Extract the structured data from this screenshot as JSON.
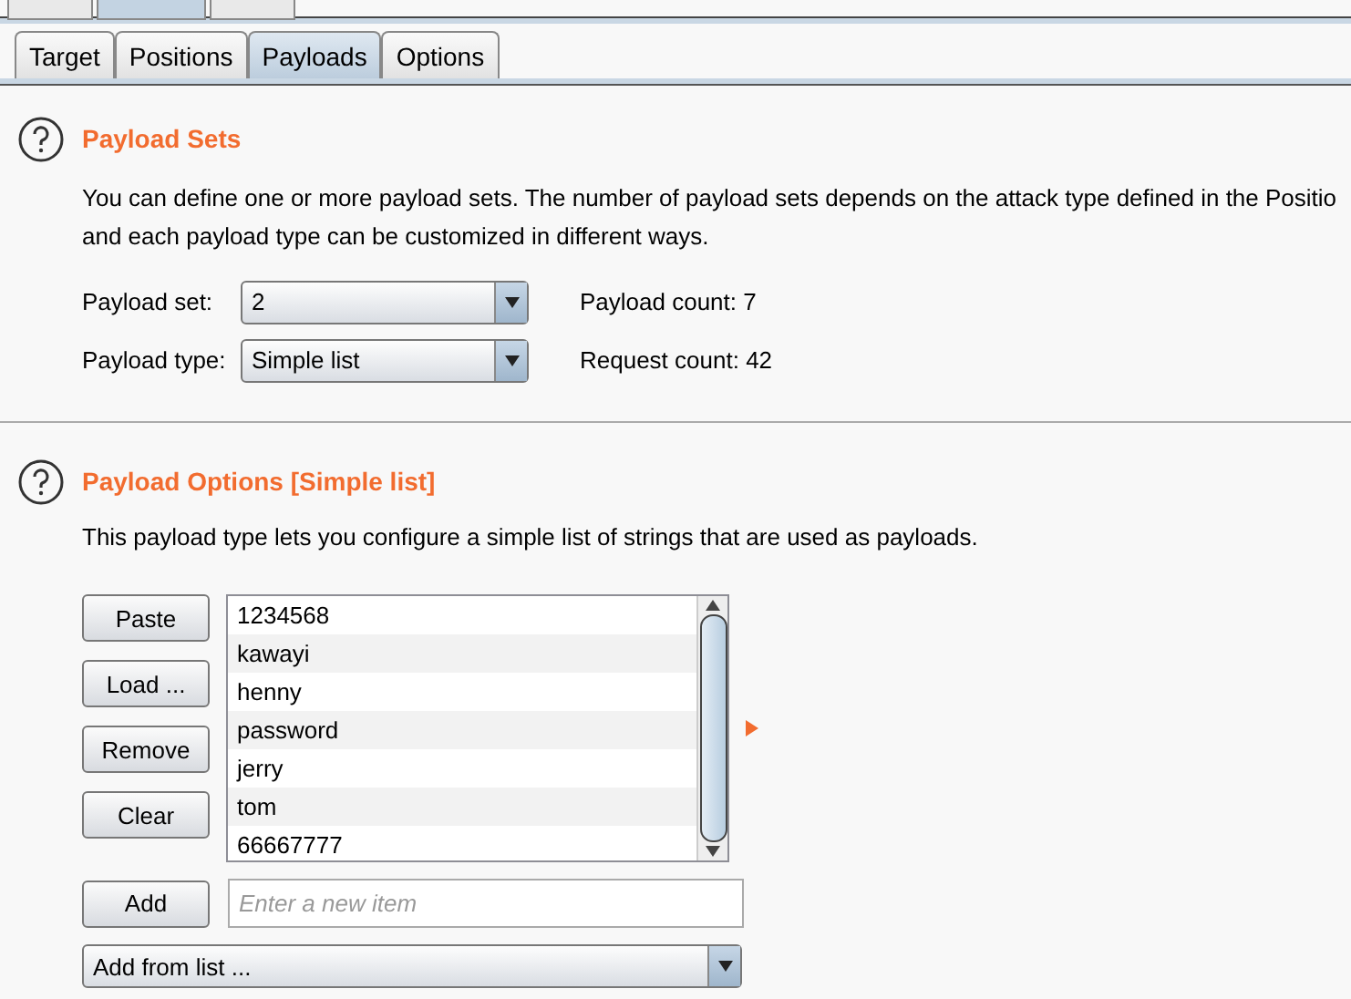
{
  "outer_tabs": [
    {
      "selected": false
    },
    {
      "selected": true
    },
    {
      "selected": false
    }
  ],
  "tabs": [
    {
      "label": "Target",
      "selected": false
    },
    {
      "label": "Positions",
      "selected": false
    },
    {
      "label": "Payloads",
      "selected": true
    },
    {
      "label": "Options",
      "selected": false
    }
  ],
  "payload_sets": {
    "title": "Payload Sets",
    "description": "You can define one or more payload sets. The number of payload sets depends on the attack type defined in the Positio",
    "description_2": "and each payload type can be customized in different ways.",
    "fields": [
      {
        "label": "Payload set:",
        "value": "2",
        "info_label": "Payload count:",
        "info_value": "7"
      },
      {
        "label": "Payload type:",
        "value": "Simple list",
        "info_label": "Request count:",
        "info_value": "42"
      }
    ]
  },
  "payload_options": {
    "title": "Payload Options [Simple list]",
    "description": "This payload type lets you configure a simple list of strings that are used as payloads.",
    "buttons": [
      "Paste",
      "Load ...",
      "Remove",
      "Clear"
    ],
    "items": [
      "1234568",
      "kawayi",
      "henny",
      "password",
      "jerry",
      "tom",
      "66667777"
    ],
    "add_button": "Add",
    "new_item": {
      "placeholder": "Enter a new item"
    },
    "add_from_list": "Add from list ..."
  }
}
